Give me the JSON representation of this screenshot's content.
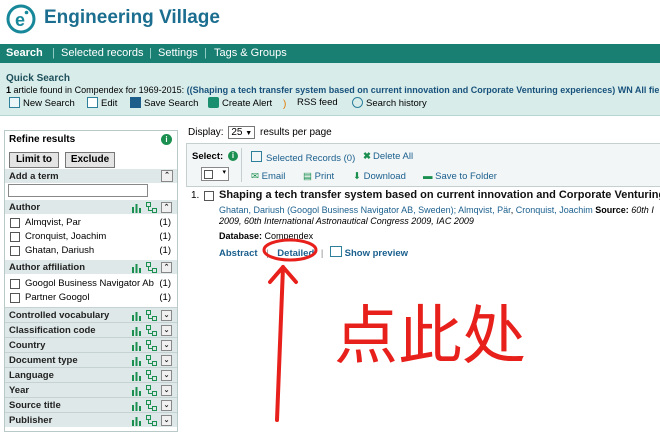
{
  "brand": {
    "name": "Engineering Village"
  },
  "nav": {
    "items": [
      "Search",
      "Selected records",
      "Settings",
      "Tags & Groups"
    ]
  },
  "quick_search": {
    "title": "Quick Search",
    "count_text": "1",
    "summary": "article found in Compendex for 1969-2015:",
    "query": "((Shaping a tech transfer system based on current innovation and Corporate Venturing experiences) WN All fields",
    "toolbar": [
      "New Search",
      "Edit",
      "Save Search",
      "Create Alert",
      "RSS feed",
      "Search history"
    ]
  },
  "refine": {
    "title": "Refine results",
    "limit_label": "Limit to",
    "exclude_label": "Exclude",
    "add_term_label": "Add a term",
    "add_term_value": "",
    "author": {
      "label": "Author",
      "items": [
        {
          "name": "Almqvist, Par",
          "count": "(1)"
        },
        {
          "name": "Cronquist, Joachim",
          "count": "(1)"
        },
        {
          "name": "Ghatan, Dariush",
          "count": "(1)"
        }
      ]
    },
    "affiliation": {
      "label": "Author affiliation",
      "items": [
        {
          "name": "Googol Business Navigator Ab",
          "count": "(1)"
        },
        {
          "name": "Partner Googol",
          "count": "(1)"
        }
      ]
    },
    "facets": [
      "Controlled vocabulary",
      "Classification code",
      "Country",
      "Document type",
      "Language",
      "Year",
      "Source title",
      "Publisher"
    ]
  },
  "results": {
    "display_label": "Display:",
    "per_page_value": "25",
    "per_page_label": "results per page",
    "select_label": "Select:",
    "selected_records": "Selected Records (0)",
    "delete_all": "Delete All",
    "email": "Email",
    "print": "Print",
    "download": "Download",
    "save_to_folder": "Save to Folder",
    "item": {
      "number": "1.",
      "title": "Shaping a tech transfer system based on current innovation and Corporate Venturing",
      "author1": "Ghatan, Dariush",
      "affil": "(Googol Business Navigator AB, Sweden);",
      "author2": "Almqvist, Pär",
      "author3": "Cronquist, Joachim",
      "source_label": "Source:",
      "source_tail": "60th I",
      "conf_line": "2009, 60th International Astronautical Congress 2009, IAC 2009",
      "db_label": "Database:",
      "db_value": "Compendex",
      "abstract": "Abstract",
      "detailed": "Detailed",
      "preview": "Show preview"
    }
  },
  "annotation": {
    "text": "点此处",
    "color": "#e8201c"
  }
}
